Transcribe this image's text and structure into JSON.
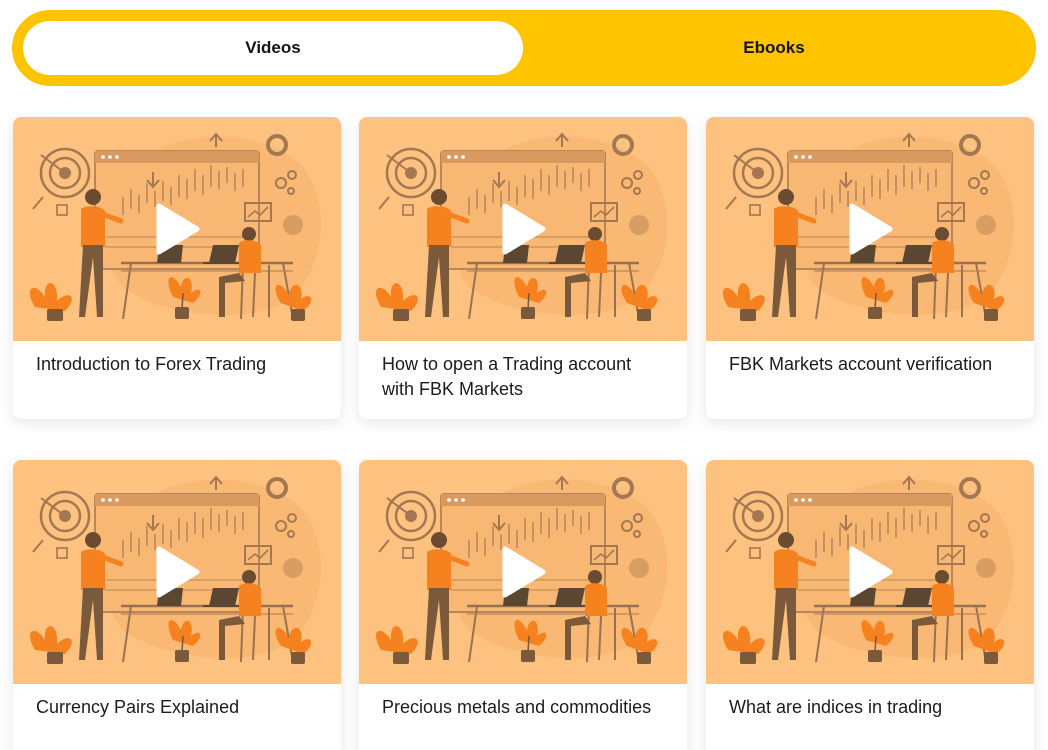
{
  "tabs": [
    {
      "label": "Videos",
      "active": true
    },
    {
      "label": "Ebooks",
      "active": false
    }
  ],
  "videos": [
    {
      "title": "Introduction to Forex Trading"
    },
    {
      "title": "How to open a Trading account with FBK Markets"
    },
    {
      "title": "FBK Markets account verification"
    },
    {
      "title": "Currency Pairs Explained"
    },
    {
      "title": "Precious metals and commodities"
    },
    {
      "title": "What are indices in trading"
    }
  ],
  "colors": {
    "accent": "#fec400",
    "thumbnail_bg": "#fdc27f",
    "illustration_orange": "#f5811f",
    "illustration_brown": "#7a5a3a"
  },
  "icons": {
    "play": "play-icon"
  }
}
